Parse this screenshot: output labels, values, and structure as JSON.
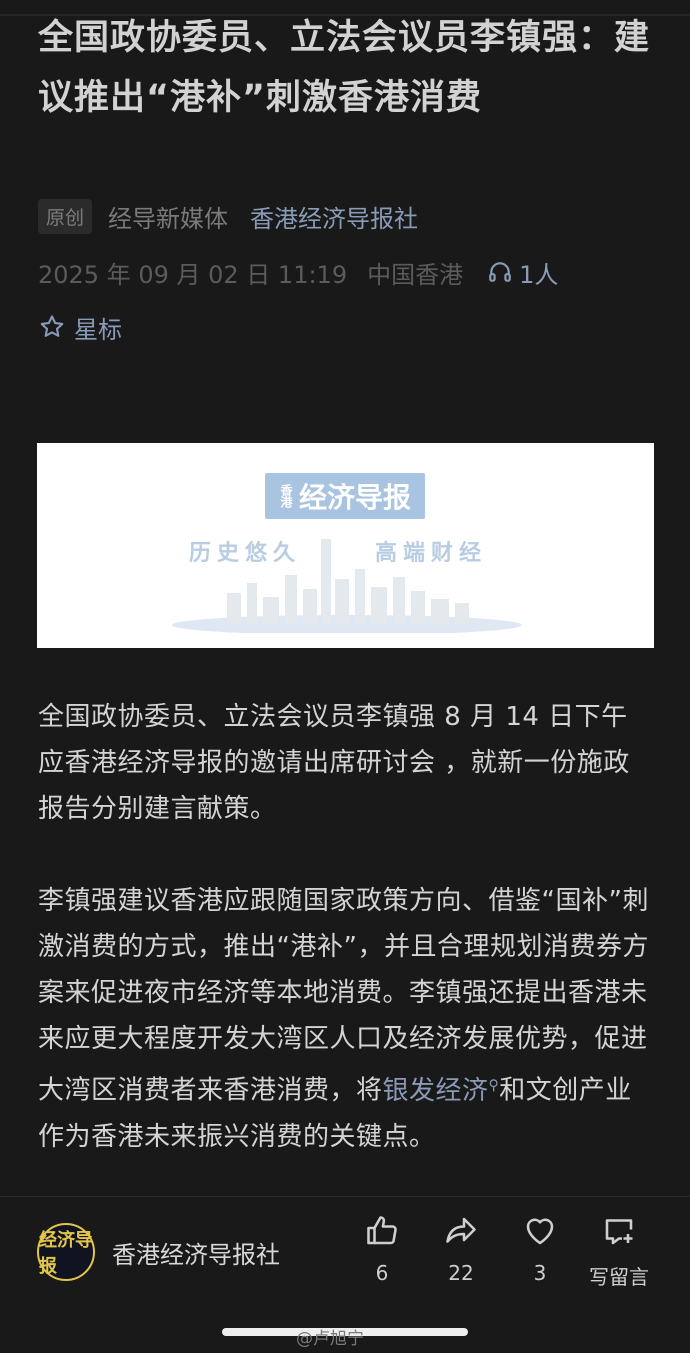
{
  "article": {
    "title": "全国政协委员、立法会议员李镇强：建议推出“港补”刺激香港消费",
    "tag": "原创",
    "source": "经导新媒体",
    "account": "香港经济导报社",
    "date": "2025 年 09 月 02 日 11:19",
    "location": "中国香港",
    "listeners": "1人",
    "star_label": "星标"
  },
  "banner": {
    "logo_text": "经济导报",
    "logo_small": "香港",
    "slogan_left": "历史悠久",
    "slogan_right": "高端财经"
  },
  "body": {
    "p1": "全国政协委员、立法会议员李镇强 8 月 14 日下午应香港经济导报的邀请出席研讨会 ，就新一份施政报告分别建言献策。",
    "p2_before_link": "李镇强建议香港应跟随国家政策方向、借鉴“国补”刺激消费的方式，推出“港补”，并且合理规划消费券方案来促进夜市经济等本地消费。李镇强还提出香港未来应更大程度开发大湾区人口及经济发展优势，促进大湾区消费者来香港消费，将",
    "p2_link": "银发经济",
    "p2_after_link": "和文创产业作为香港未来振兴消费的关键点。"
  },
  "bottom_bar": {
    "avatar_text": "经济导报",
    "account_name": "香港经济导报社",
    "like_count": "6",
    "share_count": "22",
    "heart_count": "3",
    "comment_label": "写留言"
  },
  "watermark": "@卢旭宁",
  "colors": {
    "background": "#191919",
    "link": "#8a9bb8",
    "text": "#d4d4d4"
  }
}
